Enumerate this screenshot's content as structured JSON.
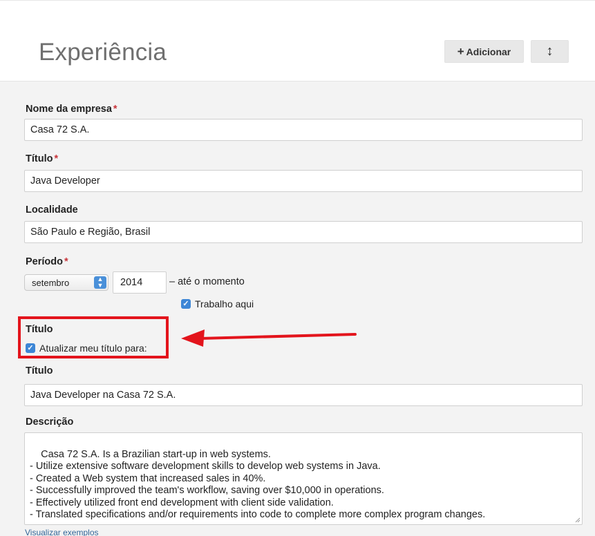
{
  "section": {
    "title": "Experiência",
    "add_label": "Adicionar",
    "add_symbol": "+",
    "sort_symbol": "↕"
  },
  "form": {
    "company": {
      "label": "Nome da empresa",
      "required_mark": "*",
      "value": "Casa 72 S.A."
    },
    "title": {
      "label": "Título",
      "required_mark": "*",
      "value": "Java Developer"
    },
    "location": {
      "label": "Localidade",
      "value": "São Paulo e Região, Brasil"
    },
    "period": {
      "label": "Período",
      "required_mark": "*",
      "month": "setembro",
      "year": "2014",
      "until_text": "– até o momento",
      "current_job_label": "Trabalho aqui",
      "current_job_checked": true
    },
    "headline_update": {
      "label": "Título",
      "checkbox_label": "Atualizar meu título para:",
      "checked": true
    },
    "new_headline": {
      "label": "Título",
      "value": "Java Developer na Casa 72 S.A."
    },
    "description": {
      "label": "Descrição",
      "value": "Casa 72 S.A. Is a Brazilian start-up in web systems.\n- Utilize extensive software development skills to develop web systems in Java.\n- Created a Web system that increased sales in 40%.\n- Successfully improved the team's workflow, saving over $10,000 in operations.\n- Effectively utilized front end development with client side validation.\n- Translated specifications and/or requirements into code to complete more complex program changes."
    },
    "examples_link": "Visualizar exemplos"
  },
  "colors": {
    "required": "#c8343a",
    "checkbox": "#3d86d6",
    "highlight": "#e3141c",
    "link": "#336699"
  }
}
